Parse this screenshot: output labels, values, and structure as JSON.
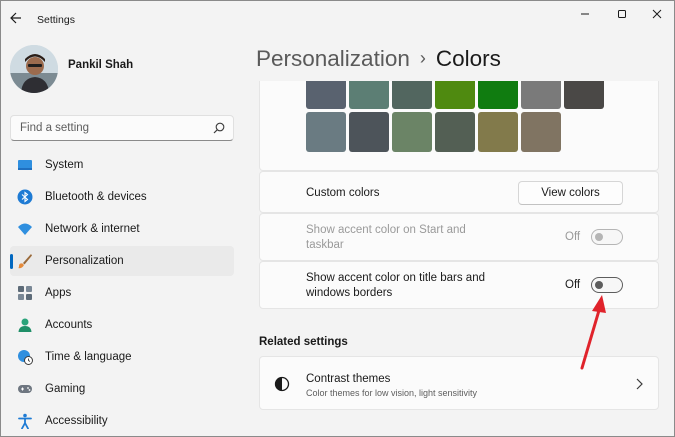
{
  "window": {
    "title": "Settings"
  },
  "profile": {
    "name": "Pankil Shah"
  },
  "search": {
    "placeholder": "Find a setting"
  },
  "sidebar": {
    "items": [
      {
        "label": "System",
        "icon": "monitor-icon",
        "active": false
      },
      {
        "label": "Bluetooth & devices",
        "icon": "bluetooth-icon",
        "active": false
      },
      {
        "label": "Network & internet",
        "icon": "wifi-icon",
        "active": false
      },
      {
        "label": "Personalization",
        "icon": "brush-icon",
        "active": true
      },
      {
        "label": "Apps",
        "icon": "apps-icon",
        "active": false
      },
      {
        "label": "Accounts",
        "icon": "person-icon",
        "active": false
      },
      {
        "label": "Time & language",
        "icon": "globe-clock-icon",
        "active": false
      },
      {
        "label": "Gaming",
        "icon": "gamepad-icon",
        "active": false
      },
      {
        "label": "Accessibility",
        "icon": "accessibility-icon",
        "active": false
      }
    ]
  },
  "breadcrumb": {
    "parent": "Personalization",
    "separator": "›",
    "current": "Colors"
  },
  "colors": {
    "swatches_row1": [
      "#59626f",
      "#5c7e74",
      "#52665f",
      "#4f8a10",
      "#107c10",
      "#7a7a7a",
      "#4a4846"
    ],
    "swatches_row2": [
      "#6a7b82",
      "#4d545a",
      "#6b8466",
      "#535f54",
      "#827a4b",
      "#807462"
    ]
  },
  "custom_colors": {
    "label": "Custom colors",
    "button": "View colors"
  },
  "accent_start": {
    "label_line1": "Show accent color on Start and",
    "label_line2": "taskbar",
    "state_text": "Off",
    "on": false,
    "enabled": false
  },
  "accent_title": {
    "label_line1": "Show accent color on title bars and",
    "label_line2": "windows borders",
    "state_text": "Off",
    "on": false,
    "enabled": true
  },
  "related": {
    "heading": "Related settings",
    "items": [
      {
        "title": "Contrast themes",
        "subtitle": "Color themes for low vision, light sensitivity",
        "icon": "contrast-icon"
      }
    ]
  },
  "accent_colors": {
    "accent": "#0067c0",
    "annotation_arrow": "#e0232b"
  }
}
